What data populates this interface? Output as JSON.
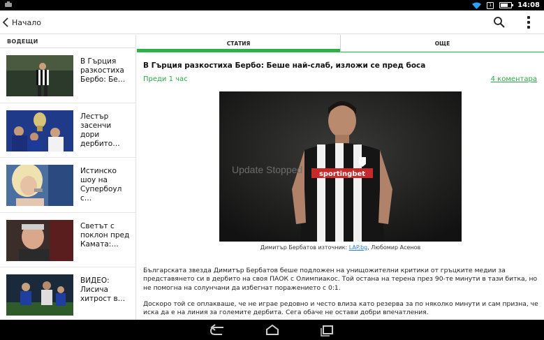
{
  "status_bar": {
    "time": "14:08",
    "sim_label": "1"
  },
  "action_bar": {
    "back_label": "Начало"
  },
  "sidebar": {
    "title": "ВОДЕЩИ",
    "items": [
      {
        "text": "В Гърция разкостиха Бербо: Бе…"
      },
      {
        "text": "Лестър засенчи дори дербито…"
      },
      {
        "text": "Истинско шоу на Супербоул с…"
      },
      {
        "text": "Светът с поклон пред Камата:…"
      },
      {
        "text": "ВИДЕО: Лисича хитрост в…"
      }
    ]
  },
  "tabs": [
    {
      "label": "СТАТИЯ",
      "active": true
    },
    {
      "label": "ОЩЕ",
      "active": false
    }
  ],
  "article": {
    "headline": "В Гърция разкостиха Бербо: Беше най-слаб, изложи се пред боса",
    "time_ago": "Преди 1 час",
    "comments": "4 коментара",
    "photo_overlay_text": "Update Stopped",
    "photo_text": "sportingbet",
    "caption_prefix": "Димитър Бербатов източник: ",
    "caption_link": "LAP.bg",
    "caption_suffix": ", Любомир Асенов",
    "paragraphs": [
      "Българската звезда Димитър Бербатов беше подложен на унищожителни критики от гръцките медии за представянето си в дербито на своя ПАОК с Олимпиакос. Той остана на терена през 90-те минути в тази битка, но не помогна на солунчани да избегнат поражението с 0:1.",
      "Доскоро той се оплакваше, че не играе редовно и често влиза като резерва за по няколко минути и сам призна, че иска да е на линия за големите дербита. Сега обаче не остави добри впечатления."
    ]
  },
  "colors": {
    "accent": "#2db24a",
    "link": "#2aa845",
    "caption_link": "#2a7fd4"
  }
}
